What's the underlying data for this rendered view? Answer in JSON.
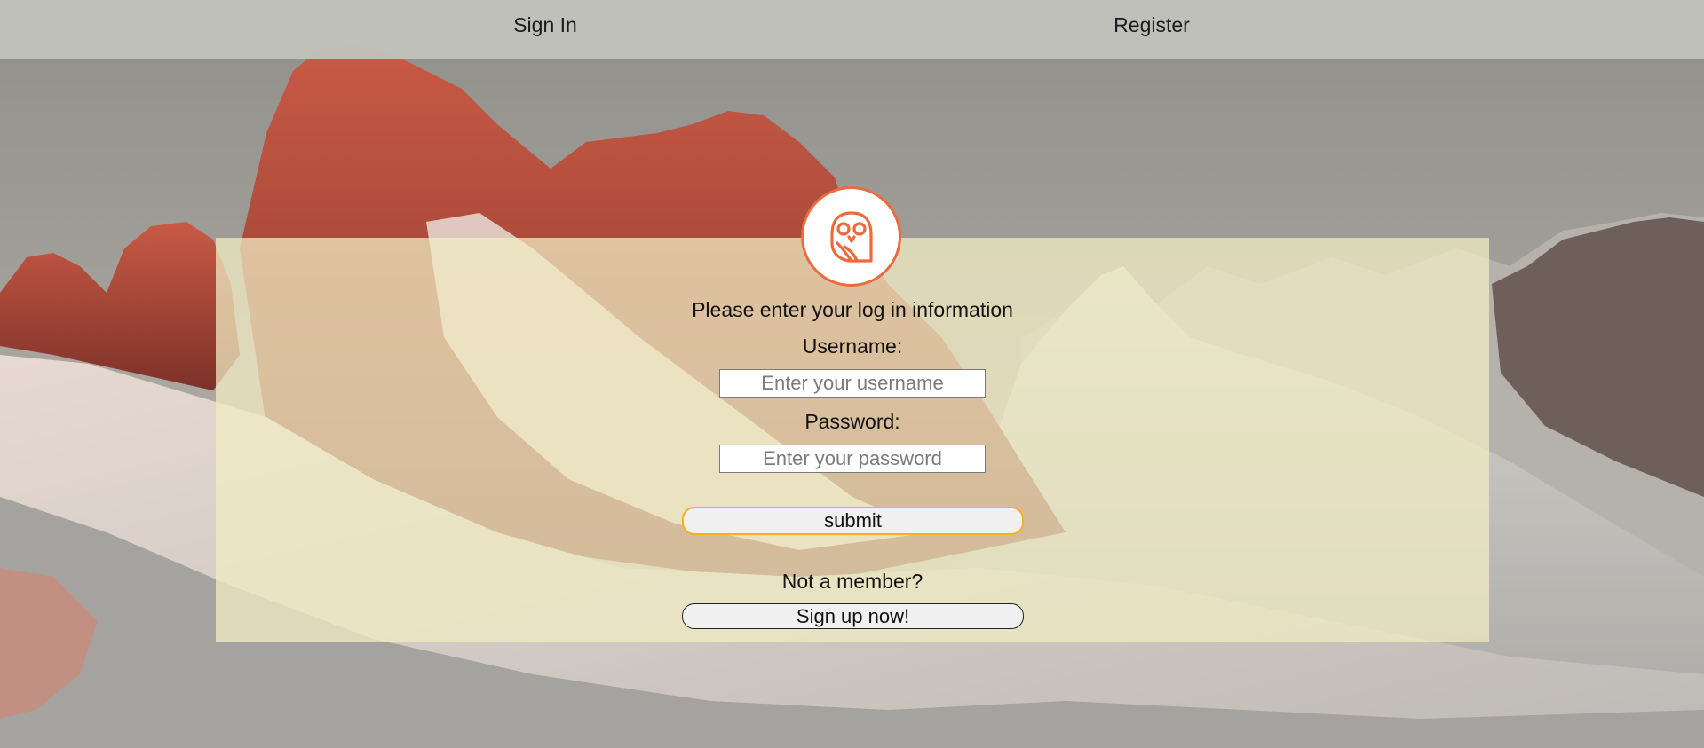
{
  "nav": {
    "signin_label": "Sign In",
    "register_label": "Register"
  },
  "login": {
    "prompt": "Please enter your log in information",
    "username_label": "Username:",
    "username_placeholder": "Enter your username",
    "password_label": "Password:",
    "password_placeholder": "Enter your password",
    "submit_label": "submit",
    "member_prompt": "Not a member?",
    "signup_label": "Sign up now!"
  },
  "logo": {
    "icon": "owl-icon"
  },
  "colors": {
    "accent": "#ec6a3b",
    "submit_border": "#f5b21b",
    "card_tint": "#f0ecc4"
  }
}
